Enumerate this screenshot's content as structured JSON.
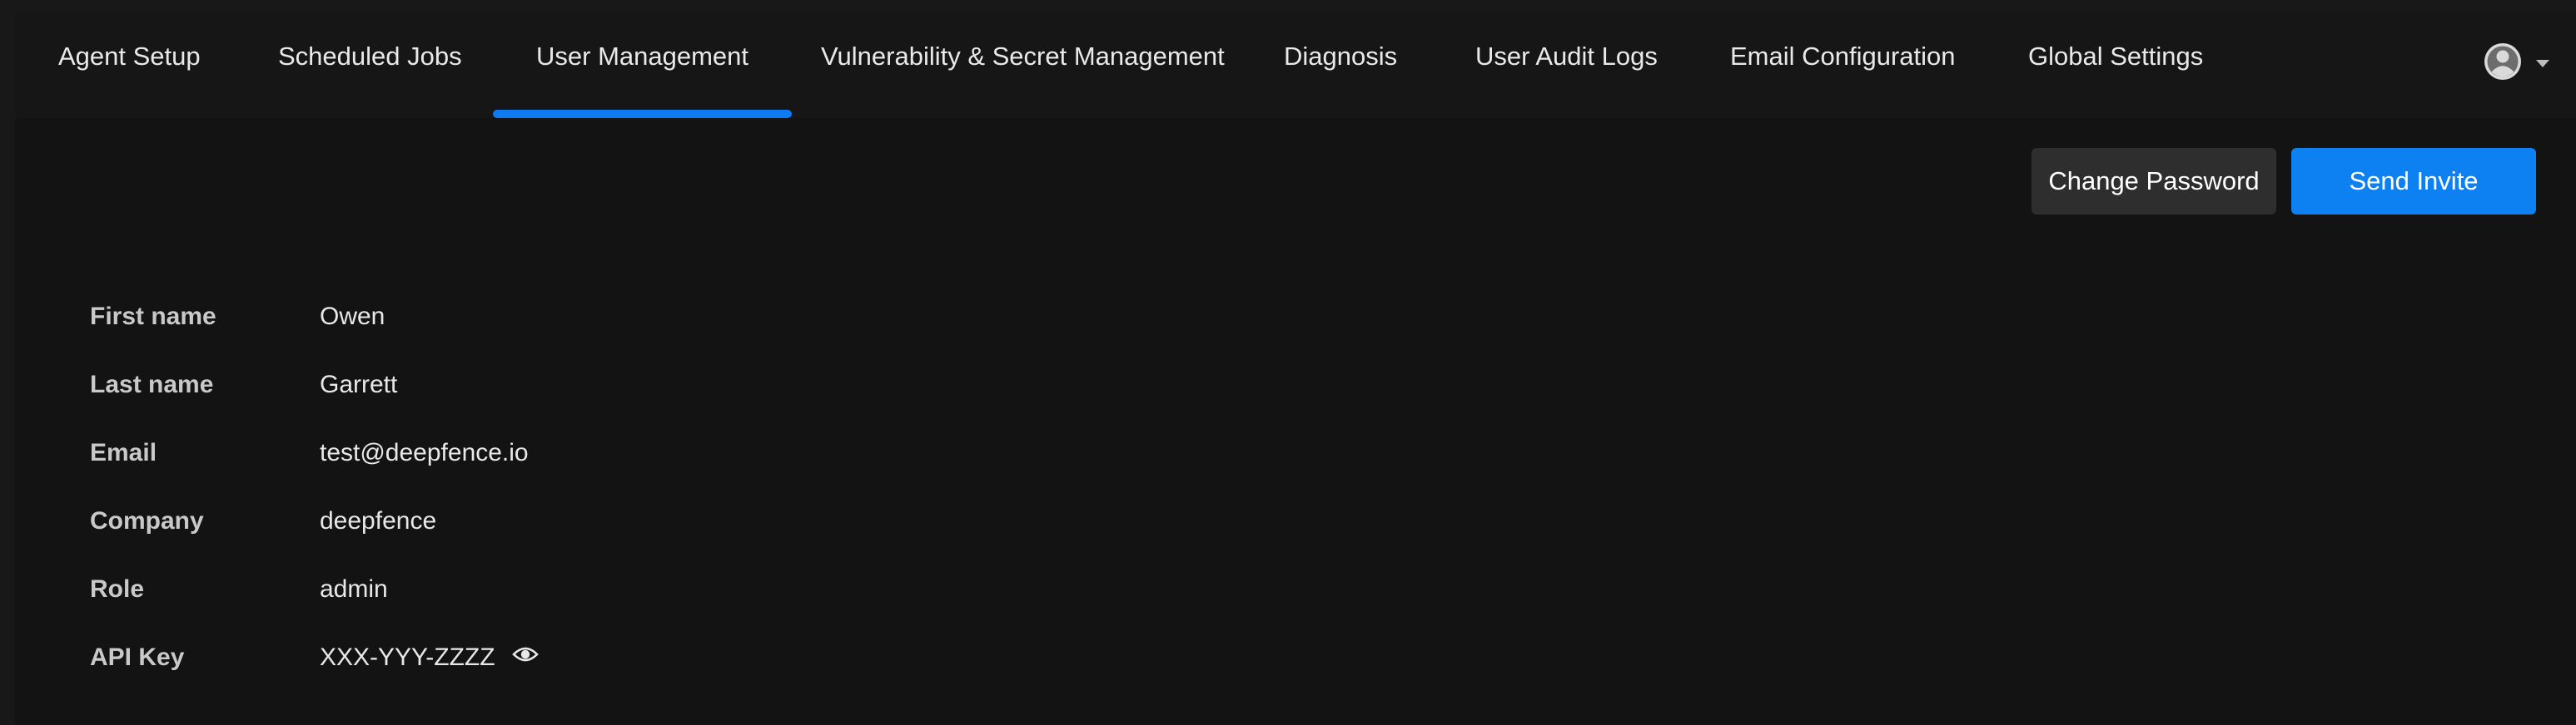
{
  "tabs": [
    {
      "label": "Agent Setup",
      "active": false
    },
    {
      "label": "Scheduled Jobs",
      "active": false
    },
    {
      "label": "User Management",
      "active": true
    },
    {
      "label": "Vulnerability & Secret Management",
      "active": false
    },
    {
      "label": "Diagnosis",
      "active": false
    },
    {
      "label": "User Audit Logs",
      "active": false
    },
    {
      "label": "Email Configuration",
      "active": false
    },
    {
      "label": "Global Settings",
      "active": false
    }
  ],
  "profile_menu": {
    "icon": "user-avatar-icon",
    "dropdown_icon": "caret-down-icon"
  },
  "actions": {
    "change_password": "Change Password",
    "send_invite": "Send Invite"
  },
  "profile": {
    "fields": [
      {
        "label": "First name",
        "value": "Owen"
      },
      {
        "label": "Last name",
        "value": "Garrett"
      },
      {
        "label": "Email",
        "value": "test@deepfence.io"
      },
      {
        "label": "Company",
        "value": "deepfence"
      },
      {
        "label": "Role",
        "value": "admin"
      },
      {
        "label": "API Key",
        "value": "XXX-YYY-ZZZZ"
      }
    ]
  },
  "colors": {
    "accent": "#0d80f2",
    "background": "#131313",
    "secondary_button": "#2e2e2e"
  }
}
